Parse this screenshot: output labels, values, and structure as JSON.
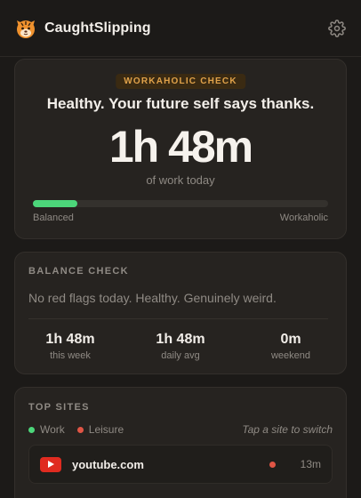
{
  "app": {
    "title": "CaughtSlipping",
    "logo_icon": "tiger-face-icon",
    "settings_icon": "gear-icon"
  },
  "workaholic": {
    "badge": "WORKAHOLIC CHECK",
    "headline": "Healthy. Your future self says thanks.",
    "time": "1h 48m",
    "subtitle": "of work today",
    "level_fraction": 0.15,
    "left_label": "Balanced",
    "right_label": "Workaholic",
    "fill_color": "#4cd67a"
  },
  "balance": {
    "title": "BALANCE CHECK",
    "message": "No red flags today. Healthy. Genuinely weird.",
    "stats": [
      {
        "value": "1h 48m",
        "label": "this week"
      },
      {
        "value": "1h 48m",
        "label": "daily avg"
      },
      {
        "value": "0m",
        "label": "weekend"
      }
    ]
  },
  "top_sites": {
    "title": "TOP SITES",
    "legend": [
      {
        "label": "Work",
        "color": "#4cd67a"
      },
      {
        "label": "Leisure",
        "color": "#e05545"
      }
    ],
    "hint": "Tap a site to switch",
    "sites": [
      {
        "name": "youtube.com",
        "time": "13m",
        "category_color": "#e05545",
        "icon": "youtube-icon"
      }
    ]
  }
}
